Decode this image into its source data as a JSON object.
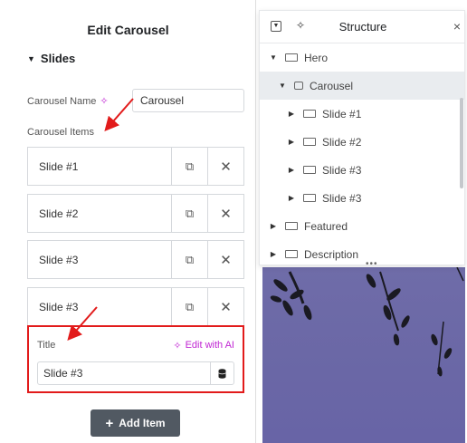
{
  "left_panel": {
    "title": "Edit Carousel",
    "section": "Slides",
    "carousel_name_label": "Carousel Name",
    "carousel_name_value": "Carousel",
    "carousel_items_label": "Carousel Items",
    "items": [
      {
        "label": "Slide #1"
      },
      {
        "label": "Slide #2"
      },
      {
        "label": "Slide #3"
      },
      {
        "label": "Slide #3"
      }
    ],
    "title_label": "Title",
    "edit_ai_label": "Edit with AI",
    "title_value": "Slide #3",
    "add_item_label": "Add Item"
  },
  "structure": {
    "title": "Structure",
    "close_glyph": "×",
    "rows": [
      {
        "label": "Hero"
      },
      {
        "label": "Carousel"
      },
      {
        "label": "Slide #1"
      },
      {
        "label": "Slide #2"
      },
      {
        "label": "Slide #3"
      },
      {
        "label": "Slide #3"
      },
      {
        "label": "Featured"
      },
      {
        "label": "Description"
      }
    ]
  },
  "colors": {
    "highlight_border": "#e21b1b",
    "ai_accent": "#c026d3",
    "add_button": "#515962",
    "selected_row": "#e9ecef"
  }
}
